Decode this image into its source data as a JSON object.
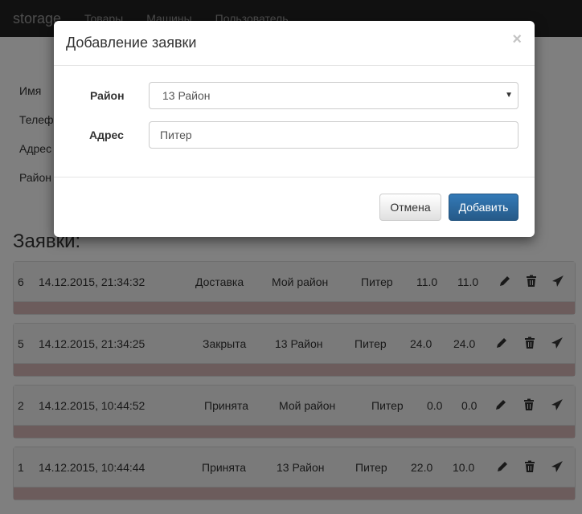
{
  "navbar": {
    "brand": "storage",
    "links": [
      "Товары",
      "Машины",
      "Пользователь"
    ]
  },
  "form": {
    "labels": [
      "Имя",
      "Телефон",
      "Адрес",
      "Район"
    ]
  },
  "orders_title": "Заявки:",
  "orders": [
    {
      "id": "6",
      "datetime": "14.12.2015, 21:34:32",
      "status": "Доставка",
      "district": "Мой район",
      "city": "Питер",
      "v1": "11.0",
      "v2": "11.0"
    },
    {
      "id": "5",
      "datetime": "14.12.2015, 21:34:25",
      "status": "Закрыта",
      "district": "13 Район",
      "city": "Питер",
      "v1": "24.0",
      "v2": "24.0"
    },
    {
      "id": "2",
      "datetime": "14.12.2015, 10:44:52",
      "status": "Принята",
      "district": "Мой район",
      "city": "Питер",
      "v1": "0.0",
      "v2": "0.0"
    },
    {
      "id": "1",
      "datetime": "14.12.2015, 10:44:44",
      "status": "Принята",
      "district": "13 Район",
      "city": "Питер",
      "v1": "22.0",
      "v2": "10.0"
    }
  ],
  "order_actions": [
    "pencil-icon",
    "trash-icon",
    "send-icon"
  ],
  "modal": {
    "title": "Добавление заявки",
    "close": "×",
    "district_label": "Район",
    "district_value": "13 Район",
    "address_label": "Адрес",
    "address_value": "Питер",
    "cancel": "Отмена",
    "submit": "Добавить"
  },
  "colors": {
    "primary": "#337ab7",
    "status_bar": "#d9b8b8",
    "navbar": "#222222"
  }
}
